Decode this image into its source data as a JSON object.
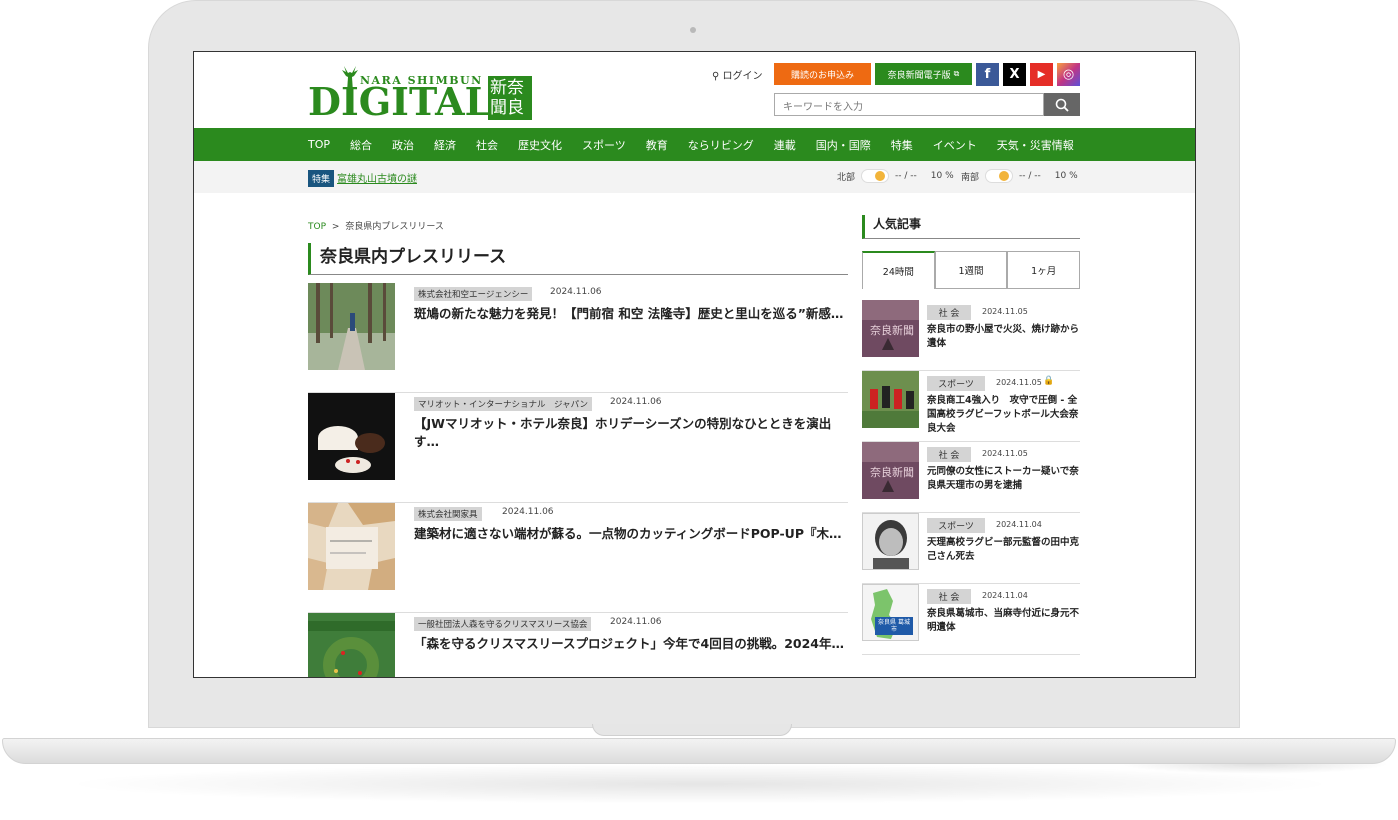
{
  "header": {
    "logo_small": "NARA SHIMBUN",
    "logo_big": "DIGITAL",
    "logo_kanji": "新奈聞良",
    "login_label": "ログイン",
    "subscribe_label": "購読のお申込み",
    "epaper_label": "奈良新聞電子版",
    "search_placeholder": "キーワードを入力",
    "sns": [
      {
        "name": "facebook-icon",
        "glyph": "f",
        "color": "#3b5998"
      },
      {
        "name": "x-icon",
        "glyph": "X",
        "color": "#000000"
      },
      {
        "name": "youtube-icon",
        "glyph": "▶",
        "color": "#e52d27"
      },
      {
        "name": "instagram-icon",
        "glyph": "◎",
        "color": "#c13584"
      }
    ]
  },
  "nav": {
    "items": [
      "TOP",
      "総合",
      "政治",
      "経済",
      "社会",
      "歴史文化",
      "スポーツ",
      "教育",
      "ならリビング",
      "連載",
      "国内・国際",
      "特集",
      "イベント",
      "天気・災害情報"
    ]
  },
  "subbar": {
    "feature_tag": "特集",
    "feature_link": "富雄丸山古墳の謎",
    "weather_north_label": "北部",
    "weather_north_temp": "-- / --",
    "weather_north_rain": "10 %",
    "weather_south_label": "南部",
    "weather_south_temp": "-- / --",
    "weather_south_rain": "10 %"
  },
  "breadcrumb": {
    "top": "TOP",
    "sep": ">",
    "current": "奈良県内プレスリリース"
  },
  "page_title": "奈良県内プレスリリース",
  "articles": [
    {
      "company": "株式会社和空エージェンシー",
      "date": "2024.11.06",
      "title": "斑鳩の新たな魅力を発見！【門前宿 和空 法隆寺】歴史と里山を巡る”新感…"
    },
    {
      "company": "マリオット・インターナショナル　ジャパン",
      "date": "2024.11.06",
      "title": "【JWマリオット・ホテル奈良】ホリデーシーズンの特別なひとときを演出す…"
    },
    {
      "company": "株式会社関家具",
      "date": "2024.11.06",
      "title": "建築材に適さない端材が蘇る。一点物のカッティングボードPOP-UP『木…"
    },
    {
      "company": "一般社団法人森を守るクリスマスリース協会",
      "date": "2024.11.06",
      "title": "「森を守るクリスマスリースプロジェクト」今年で4回目の挑戦。2024年…"
    }
  ],
  "sidebar": {
    "title": "人気記事",
    "tabs": [
      "24時間",
      "1週間",
      "1ヶ月"
    ],
    "popular": [
      {
        "category": "社 会",
        "date": "2024.11.05",
        "title": "奈良市の野小屋で火災、焼け跡から遺体"
      },
      {
        "category": "スポーツ",
        "date": "2024.11.05",
        "title": "奈良商工4強入り　攻守で圧倒 - 全国高校ラグビーフットボール大会奈良大会"
      },
      {
        "category": "社 会",
        "date": "2024.11.05",
        "title": "元同僚の女性にストーカー疑いで奈良県天理市の男を逮捕"
      },
      {
        "category": "スポーツ",
        "date": "2024.11.04",
        "title": "天理高校ラグビー部元監督の田中克己さん死去"
      },
      {
        "category": "社 会",
        "date": "2024.11.04",
        "title": "奈良県葛城市、当麻寺付近に身元不明遺体"
      }
    ],
    "map_label": "奈良県 葛城市"
  },
  "colors": {
    "brand_green": "#2b8a1e",
    "subscribe_orange": "#ee6a12",
    "feature_blue": "#19557f"
  }
}
